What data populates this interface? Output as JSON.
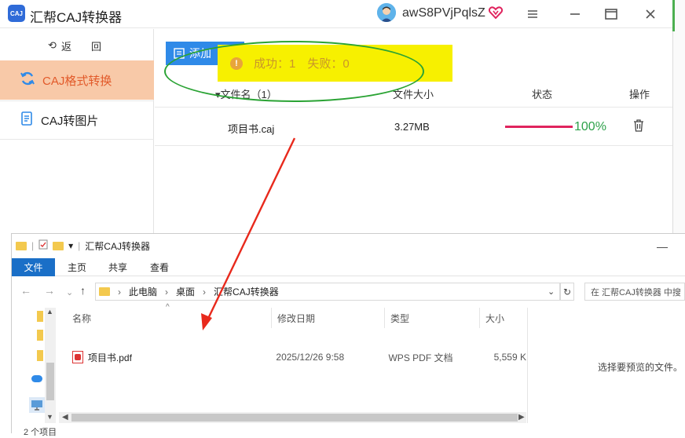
{
  "app": {
    "logo_text": "CAJ",
    "title": "汇帮CAJ转换器",
    "username": "awS8PVjPqlsZ",
    "vip_icon": "vip-heart-icon",
    "window_controls": [
      "menu-icon",
      "minimize-icon",
      "maximize-icon",
      "close-icon"
    ]
  },
  "sidebar": {
    "back_label": "返　回",
    "items": [
      {
        "label": "CAJ格式转换",
        "icon": "refresh-icon",
        "active": true
      },
      {
        "label": "CAJ转图片",
        "icon": "document-icon",
        "active": false
      }
    ]
  },
  "toolbar": {
    "add_label": "添加"
  },
  "toast": {
    "text": "成功：1　失败：0",
    "icon": "info-icon"
  },
  "table": {
    "headers": [
      "▾文件名（1）",
      "文件大小",
      "状态",
      "操作"
    ],
    "rows": [
      {
        "name": "项目书.caj",
        "size": "3.27MB",
        "progress": 1.0,
        "progress_text": "100%",
        "action_icon": "trash-icon"
      }
    ]
  },
  "colors": {
    "accent": "#2f8ae8",
    "active_nav_bg": "#f8c9a8",
    "active_nav_text": "#e25a2a",
    "toast_bg": "#f7f000",
    "progress": "#e0245e",
    "success": "#2da14a",
    "annotation_green": "#2aa334",
    "annotation_red": "#e8291c"
  },
  "explorer": {
    "title": "汇帮CAJ转换器",
    "ribbon_tabs": [
      "文件",
      "主页",
      "共享",
      "查看"
    ],
    "breadcrumb": [
      "此电脑",
      "桌面",
      "汇帮CAJ转换器"
    ],
    "search_placeholder": "在 汇帮CAJ转换器 中搜",
    "columns": [
      "名称",
      "修改日期",
      "类型",
      "大小"
    ],
    "files": [
      {
        "name": "项目书.pdf",
        "date": "2025/12/26 9:58",
        "type": "WPS PDF 文档",
        "size": "5,559 K"
      }
    ],
    "preview_text": "选择要预览的文件。",
    "status_text": "2 个项目"
  }
}
